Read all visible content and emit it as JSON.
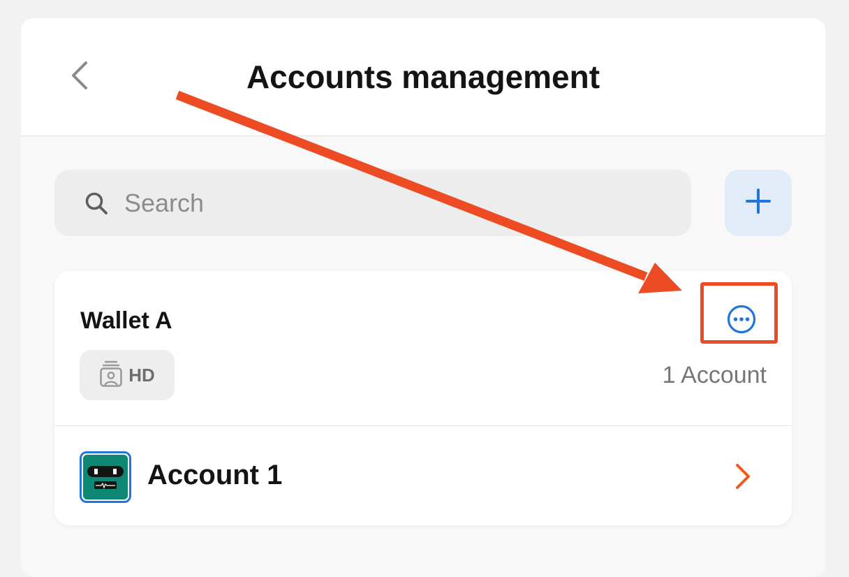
{
  "header": {
    "back_icon": "chevron-left-icon",
    "title": "Accounts management"
  },
  "search": {
    "icon": "search-icon",
    "placeholder": "Search",
    "value": ""
  },
  "add_button": {
    "icon": "plus-icon",
    "accent": "#1f76d8"
  },
  "wallet": {
    "name": "Wallet A",
    "badge": {
      "icon": "hd-wallet-icon",
      "label": "HD"
    },
    "more_icon": "more-horizontal-circle-icon",
    "account_count": "1 Account",
    "accounts": [
      {
        "name": "Account 1",
        "avatar_icon": "robot-avatar-icon",
        "chevron_icon": "chevron-right-icon"
      }
    ]
  },
  "annotation": {
    "color": "#ec4b24",
    "target": "wallet-more-button"
  },
  "colors": {
    "accent_blue": "#1f76d8",
    "accent_orange": "#f05a14",
    "annotation_red": "#ec4b24",
    "avatar_teal": "#0e8774"
  }
}
